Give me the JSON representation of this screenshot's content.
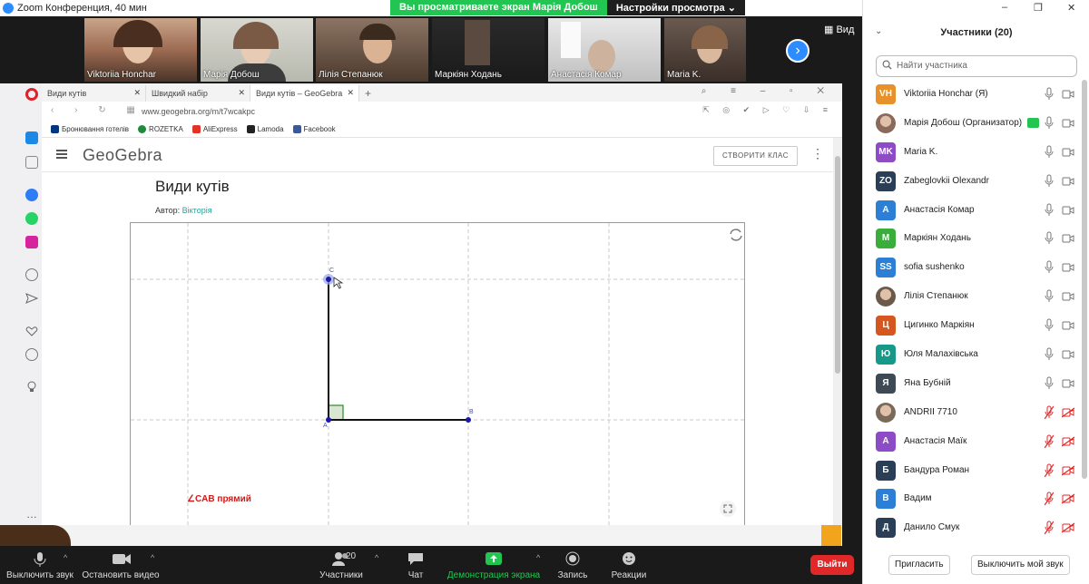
{
  "window": {
    "title": "Zoom Конференция, 40 мин",
    "share_banner": "Вы просматриваете экран Марія Добош",
    "view_settings": "Настройки просмотра ⌄",
    "view_label": "Вид"
  },
  "video_tiles": [
    {
      "name": "Viktoriia Honchar"
    },
    {
      "name": "Марія Добош"
    },
    {
      "name": "Лілія Степанюк"
    },
    {
      "name": "Маркіян Ходань"
    },
    {
      "name": "Анастасія Комар"
    },
    {
      "name": "Maria K."
    }
  ],
  "browser": {
    "tabs": [
      {
        "label": "Види кутів"
      },
      {
        "label": "Швидкий набір"
      },
      {
        "label": "Види кутів – GeoGebra"
      }
    ],
    "url": "www.geogebra.org/m/t7wcakpc",
    "bookmarks": [
      "Бронювання готелів",
      "ROZETKA",
      "AliExpress",
      "Lamoda",
      "Facebook"
    ]
  },
  "geogebra": {
    "logo": "GeoGebra",
    "create_class": "СТВОРИТИ КЛАС",
    "title": "Види кутів",
    "author_label": "Автор:",
    "author_name": "Вікторія",
    "point_a": "A",
    "point_b": "B",
    "point_c": "C",
    "angle_label": "∠CAB прямий"
  },
  "toolbar": {
    "mute": "Выключить звук",
    "stop_video": "Остановить видео",
    "participants": "Участники",
    "participants_count": "20",
    "chat": "Чат",
    "share": "Демонстрация экрана",
    "record": "Запись",
    "reactions": "Реакции",
    "leave": "Выйти"
  },
  "panel": {
    "title": "Участники (20)",
    "search_placeholder": "Найти участника",
    "invite": "Пригласить",
    "mute_me": "Выключить мой звук",
    "participants": [
      {
        "initials": "VH",
        "name": "Viktoriia Honchar (Я)",
        "color": "#e8912b",
        "muted": false
      },
      {
        "initials": "",
        "name": "Марія Добош (Организатор)",
        "color": "#8a6a5a",
        "muted": false,
        "photo": true,
        "host": true
      },
      {
        "initials": "MK",
        "name": "Maria K.",
        "color": "#8e4bc6",
        "muted": false
      },
      {
        "initials": "ZO",
        "name": "Zabeglovkii Olexandr",
        "color": "#2a3f55",
        "muted": false
      },
      {
        "initials": "A",
        "name": "Анастасія Комар",
        "color": "#2d7fd6",
        "muted": false
      },
      {
        "initials": "M",
        "name": "Маркіян Ходань",
        "color": "#3aae3a",
        "muted": false
      },
      {
        "initials": "SS",
        "name": "sofia sushenko",
        "color": "#2d7fd6",
        "muted": false
      },
      {
        "initials": "",
        "name": "Лілія Степанюк",
        "color": "#6b5a4a",
        "muted": false,
        "photo": true
      },
      {
        "initials": "Ц",
        "name": "Цигинко Маркіян",
        "color": "#d6561f",
        "muted": false
      },
      {
        "initials": "Ю",
        "name": "Юля Малахівська",
        "color": "#17998a",
        "muted": false
      },
      {
        "initials": "Я",
        "name": "Яна Бубній",
        "color": "#3d4a55",
        "muted": false
      },
      {
        "initials": "",
        "name": "ANDRII 7710",
        "color": "#7a6a5a",
        "muted": true,
        "photo": true
      },
      {
        "initials": "A",
        "name": "Анастасія Маїк",
        "color": "#8e4bc6",
        "muted": true
      },
      {
        "initials": "Б",
        "name": "Бандура Роман",
        "color": "#2a3f55",
        "muted": true
      },
      {
        "initials": "В",
        "name": "Вадим",
        "color": "#2d7fd6",
        "muted": true
      },
      {
        "initials": "Д",
        "name": "Данило Смук",
        "color": "#2a3f55",
        "muted": true
      }
    ]
  },
  "colors": {
    "zoom_blue": "#2d8cff",
    "green": "#23c552",
    "leave_red": "#e02828",
    "geo_point": "#1a1aa6",
    "angle_label": "#d01a1a"
  }
}
